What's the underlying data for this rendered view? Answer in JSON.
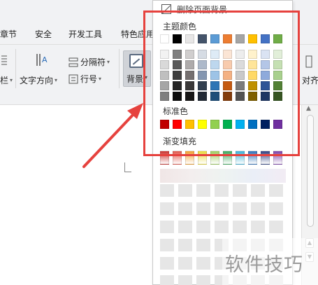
{
  "ribbon": {
    "tabs": [
      "章节",
      "安全",
      "开发工具",
      "特色应用"
    ],
    "buttons": {
      "columns_partial": "栏",
      "text_direction": "文字方向",
      "separator": "分隔符",
      "line_number": "行号",
      "background": "背景",
      "align_partial": "对齐"
    },
    "icons": [
      "text-direction-icon",
      "separator-icon",
      "line-number-icon",
      "background-icon"
    ]
  },
  "panel": {
    "delete_background_label": "删除页面背景",
    "theme_colors_label": "主题颜色",
    "standard_colors_label": "标准色",
    "gradient_fill_label": "渐变填充",
    "theme_top_row": [
      "#ffffff",
      "#000000",
      "#e7e6e6",
      "#44546a",
      "#5b9bd5",
      "#ed7d31",
      "#a5a5a5",
      "#ffc000",
      "#4472c4",
      "#70ad47"
    ],
    "theme_shades": [
      [
        "#f2f2f2",
        "#7f7f7f",
        "#d0cece",
        "#d6dce4",
        "#deebf6",
        "#fbe5d5",
        "#ededed",
        "#fff2cc",
        "#dae3f3",
        "#e2efd9"
      ],
      [
        "#d9d9d9",
        "#595959",
        "#aeabab",
        "#adb9ca",
        "#bdd7ee",
        "#f8cbad",
        "#dbdbdb",
        "#ffe599",
        "#b4c6e7",
        "#c5e0b3"
      ],
      [
        "#bfbfbf",
        "#3f3f3f",
        "#757070",
        "#8496b0",
        "#9dc3e6",
        "#f4b183",
        "#c9c9c9",
        "#ffd966",
        "#8eaadb",
        "#a8d08d"
      ],
      [
        "#a6a6a6",
        "#262626",
        "#3a3838",
        "#323f4f",
        "#2e75b5",
        "#c55a11",
        "#7b7b7b",
        "#bf9000",
        "#2f5496",
        "#538135"
      ],
      [
        "#7f7f7f",
        "#0d0d0d",
        "#171616",
        "#222a35",
        "#1e4e79",
        "#833c0b",
        "#525252",
        "#7f6000",
        "#1f3864",
        "#375623"
      ]
    ],
    "standard_colors": [
      "#c00000",
      "#ff0000",
      "#ffc000",
      "#ffff00",
      "#92d050",
      "#00b050",
      "#00b0f0",
      "#0070c0",
      "#002060",
      "#7030a0"
    ],
    "gradient_colors": [
      "#c9302c",
      "#e05548",
      "#f0a030",
      "#e8d83a",
      "#9ccc5c",
      "#3aa95a",
      "#3ab0d8",
      "#2c6fb8",
      "#2c3e80",
      "#7a3fa8"
    ]
  },
  "watermark": {
    "text": "软件技巧"
  }
}
